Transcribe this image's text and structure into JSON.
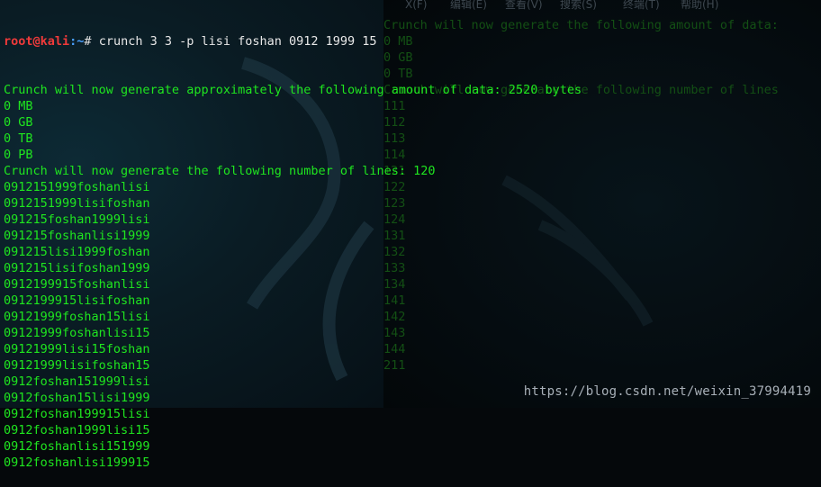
{
  "menubar": {
    "items": [
      "X(F)",
      "编辑(E)",
      "查看(V)",
      "搜索(S)",
      "终端(T)",
      "帮助(H)"
    ]
  },
  "background_terminal": {
    "lines": [
      "Crunch will now generate the following amount of data:",
      "0 MB",
      "0 GB",
      "0 TB",
      "Crunch will now generate the following number of lines",
      "111",
      "112",
      "113",
      "114",
      "121",
      "122",
      "123",
      "124",
      "131",
      "132",
      "133",
      "134",
      "141",
      "142",
      "143",
      "144",
      "211"
    ]
  },
  "terminal": {
    "prompt": {
      "user_host": "root@kali",
      "path": ":~",
      "symbol": "#",
      "command": " crunch 3 3 -p lisi foshan 0912 1999 15"
    },
    "output": [
      "Crunch will now generate approximately the following amount of data: 2520 bytes",
      "0 MB",
      "0 GB",
      "0 TB",
      "0 PB",
      "Crunch will now generate the following number of lines: 120",
      "0912151999foshanlisi",
      "0912151999lisifoshan",
      "091215foshan1999lisi",
      "091215foshanlisi1999",
      "091215lisi1999foshan",
      "091215lisifoshan1999",
      "0912199915foshanlisi",
      "0912199915lisifoshan",
      "09121999foshan15lisi",
      "09121999foshanlisi15",
      "09121999lisi15foshan",
      "09121999lisifoshan15",
      "0912foshan151999lisi",
      "0912foshan15lisi1999",
      "0912foshan199915lisi",
      "0912foshan1999lisi15",
      "0912foshanlisi151999",
      "0912foshanlisi199915"
    ]
  },
  "watermark": "https://blog.csdn.net/weixin_37994419",
  "colors": {
    "output_green": "#1fe61f",
    "prompt_red": "#f03a3a",
    "prompt_blue": "#4aa0ff",
    "dim_green": "#134f14"
  }
}
